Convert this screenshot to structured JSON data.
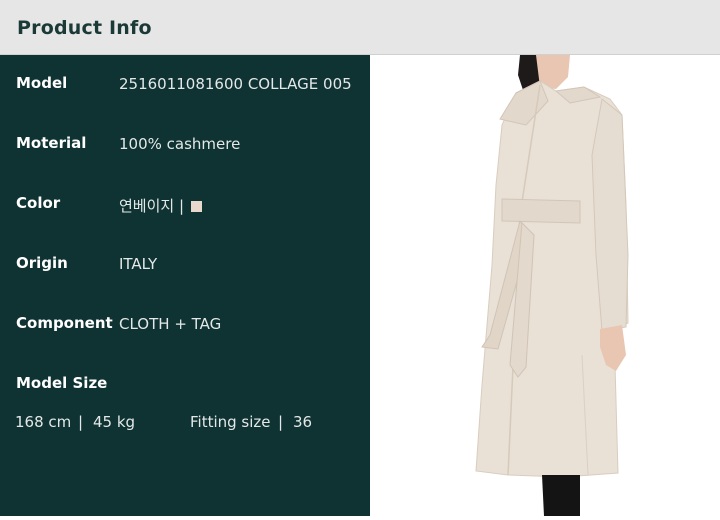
{
  "header": {
    "title": "Product Info"
  },
  "specs": [
    {
      "label": "Model",
      "value": "2516011081600 COLLAGE 005"
    },
    {
      "label": "Moterial",
      "value": "100% cashmere"
    },
    {
      "label": "Color",
      "value": "연베이지 |"
    },
    {
      "label": "Origin",
      "value": "ITALY"
    },
    {
      "label": "Component",
      "value": "CLOTH + TAG"
    }
  ],
  "color_swatch": "#e8d9cc",
  "model_size": {
    "label": "Model Size",
    "height": "168 cm",
    "separator": "|",
    "weight": "45 kg",
    "fitting_label": "Fitting size",
    "fitting_value": "36"
  },
  "colors": {
    "panel_bg": "#0f3232",
    "header_bg": "#e6e6e6",
    "coat": "#e9e0d6"
  }
}
